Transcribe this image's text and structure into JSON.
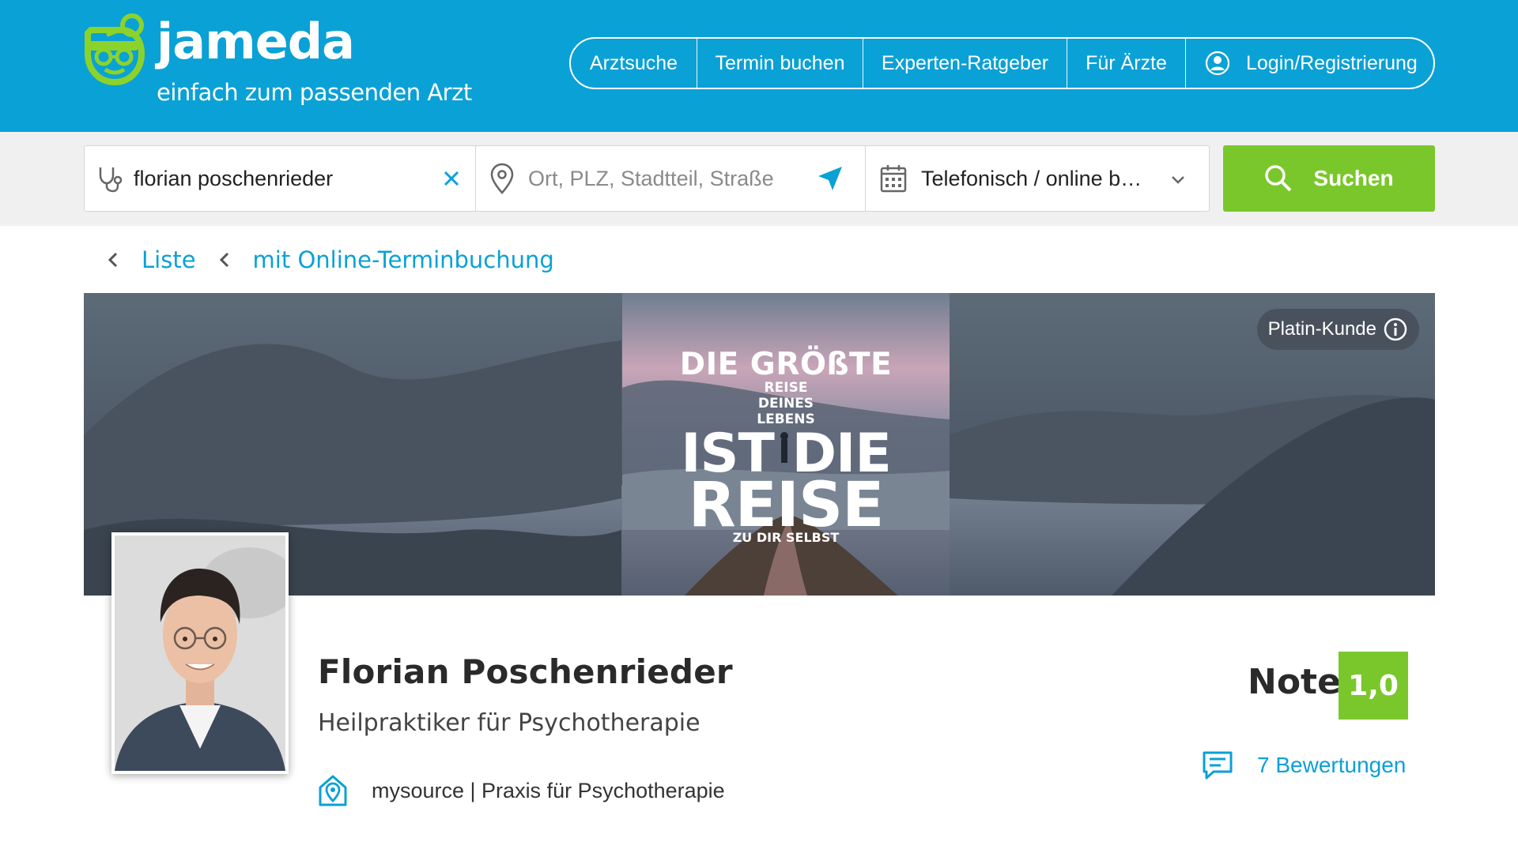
{
  "header": {
    "brand": "jameda",
    "tagline": "einfach zum passenden Arzt",
    "logo_icon": "doctor-face-icon",
    "nav": [
      {
        "label": "Arztsuche"
      },
      {
        "label": "Termin buchen"
      },
      {
        "label": "Experten-Ratgeber"
      },
      {
        "label": "Für Ärzte"
      },
      {
        "label": "Login/Registrierung",
        "icon": "user-icon"
      }
    ]
  },
  "search": {
    "query": "florian poschenrieder",
    "location_placeholder": "Ort, PLZ, Stadtteil, Straße",
    "appointment_type": "Telefonisch / online b…",
    "button_label": "Suchen"
  },
  "breadcrumb": {
    "items": [
      "Liste",
      "mit Online-Terminbuchung"
    ]
  },
  "banner": {
    "line1": "DIE GRÖßTE",
    "line2": "REISE",
    "line3": "DEINES",
    "line4": "LEBENS",
    "line5": "IST DIE",
    "line6": "REISE",
    "line7": "ZU DIR SELBST",
    "badge": "Platin-Kunde"
  },
  "profile": {
    "name": "Florian Poschenrieder",
    "specialty": "Heilpraktiker für Psychotherapie",
    "practice": "mysource | Praxis für Psychotherapie",
    "note_label": "Note",
    "note_value": "1,0",
    "reviews": "7 Bewertungen"
  },
  "colors": {
    "brand_blue": "#0aa1d6",
    "brand_green": "#7ac72b",
    "logo_green": "#8bd32b"
  }
}
